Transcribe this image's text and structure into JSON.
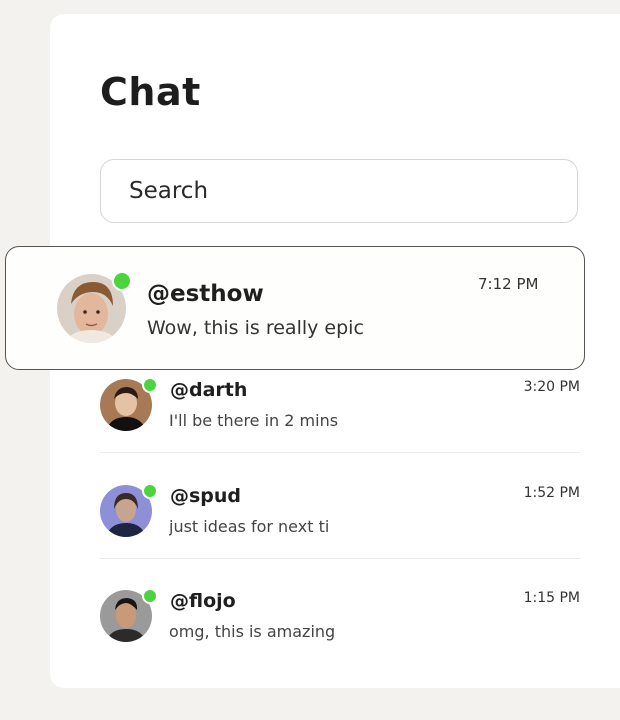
{
  "header": {
    "title": "Chat"
  },
  "search": {
    "placeholder": "Search"
  },
  "chats": [
    {
      "handle": "@esthow",
      "preview": "Wow, this is really epic",
      "time": "7:12 PM",
      "online": true,
      "avatar": "avatar-esthow"
    },
    {
      "handle": "@darth",
      "preview": "I'll be there in 2 mins",
      "time": "3:20 PM",
      "online": true,
      "avatar": "avatar-darth"
    },
    {
      "handle": "@spud",
      "preview": "just ideas for next time",
      "time": "1:52 PM",
      "online": true,
      "avatar": "avatar-spud"
    },
    {
      "handle": "@flojo",
      "preview": "omg, this is amazing",
      "time": "1:15 PM",
      "online": true,
      "avatar": "avatar-flojo"
    }
  ],
  "colors": {
    "online": "#4cd43f",
    "background": "#f3f2ef",
    "card": "#ffffff",
    "text": "#1f1f1f"
  }
}
